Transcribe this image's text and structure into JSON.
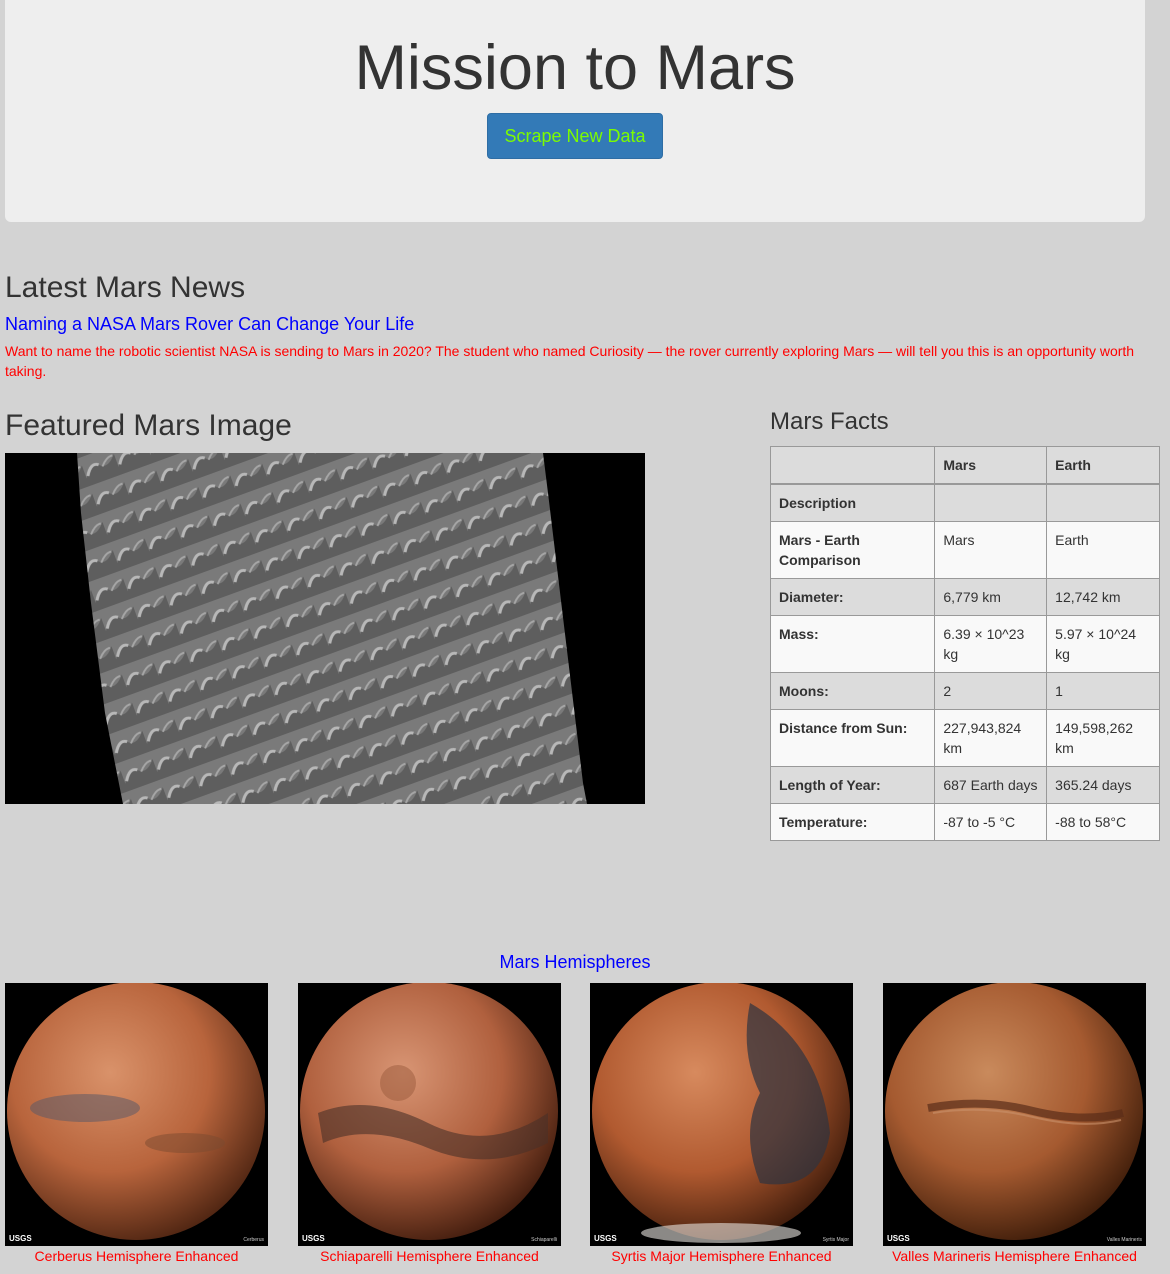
{
  "header": {
    "title": "Mission to Mars",
    "scrape_label": "Scrape New Data"
  },
  "news": {
    "heading": "Latest Mars News",
    "title": "Naming a NASA Mars Rover Can Change Your Life",
    "body": "Want to name the robotic scientist NASA is sending to Mars in 2020? The student who named Curiosity — the rover currently exploring Mars — will tell you this is an opportunity worth taking."
  },
  "featured": {
    "heading": "Featured Mars Image"
  },
  "facts": {
    "heading": "Mars Facts",
    "columns": [
      "",
      "Mars",
      "Earth"
    ],
    "rows": [
      {
        "label": "Description",
        "mars": "",
        "earth": ""
      },
      {
        "label": "Mars - Earth Comparison",
        "mars": "Mars",
        "earth": "Earth"
      },
      {
        "label": "Diameter:",
        "mars": "6,779 km",
        "earth": "12,742 km"
      },
      {
        "label": "Mass:",
        "mars": "6.39 × 10^23 kg",
        "earth": "5.97 × 10^24 kg"
      },
      {
        "label": "Moons:",
        "mars": "2",
        "earth": "1"
      },
      {
        "label": "Distance from Sun:",
        "mars": "227,943,824 km",
        "earth": "149,598,262 km"
      },
      {
        "label": "Length of Year:",
        "mars": "687 Earth days",
        "earth": "365.24 days"
      },
      {
        "label": "Temperature:",
        "mars": "-87 to -5 °C",
        "earth": "-88 to 58°C"
      }
    ]
  },
  "hemispheres": {
    "heading": "Mars Hemispheres",
    "items": [
      {
        "title": "Cerberus Hemisphere Enhanced",
        "logo": "USGS",
        "credit": "Cerberus"
      },
      {
        "title": "Schiaparelli Hemisphere Enhanced",
        "logo": "USGS",
        "credit": "Schiaparelli"
      },
      {
        "title": "Syrtis Major Hemisphere Enhanced",
        "logo": "USGS",
        "credit": "Syrtis Major"
      },
      {
        "title": "Valles Marineris Hemisphere Enhanced",
        "logo": "USGS",
        "credit": "Valles Marineris"
      }
    ]
  }
}
